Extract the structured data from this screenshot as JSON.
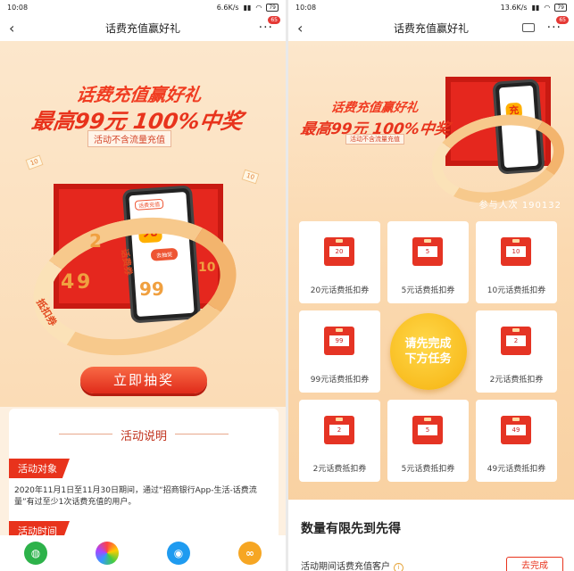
{
  "left": {
    "status": {
      "time": "10:08",
      "net": "6.6K/s",
      "battery": "79"
    },
    "nav": {
      "title": "话费充值赢好礼",
      "more": "···",
      "badge": "65"
    },
    "hero": {
      "headline": "话费充值赢好礼",
      "prize_line": "最高99元  100%中奖",
      "note": "活动不含流量充值",
      "app_header": "话费充值",
      "chong": "充",
      "phone_btn": "去抽奖",
      "ribbon_nums": [
        "2",
        "4",
        "9",
        "99",
        "10",
        "10",
        "10"
      ],
      "ribbon_words": [
        "抵扣券",
        "话费券"
      ]
    },
    "draw_button": "立即抽奖",
    "card": {
      "title": "活动说明",
      "tag1": "活动对象",
      "para": "2020年11月1日至11月30日期间，通过“招商银行App-生活-话费流量”有过至少1次话费充值的用户。",
      "tag2": "活动时间"
    },
    "share_icons": [
      "wechat-icon",
      "moments-icon",
      "qq-icon",
      "link-icon"
    ]
  },
  "right": {
    "status": {
      "time": "10:08",
      "net": "13.6K/s",
      "battery": "79"
    },
    "nav": {
      "title": "话费充值赢好礼",
      "badge": "65"
    },
    "hero": {
      "headline": "话费充值赢好礼",
      "prize_line": "最高99元  100%中奖",
      "note": "活动不含流量充值"
    },
    "participants": "参与人次 190132",
    "prizes": [
      {
        "amount": "20",
        "label": "20元话费抵扣券"
      },
      {
        "amount": "5",
        "label": "5元话费抵扣券"
      },
      {
        "amount": "10",
        "label": "10元话费抵扣券"
      },
      {
        "amount": "99",
        "label": "99元话费抵扣券"
      },
      {
        "amount": "2",
        "label": "2元话费抵扣券"
      },
      {
        "amount": "2",
        "label": "2元话费抵扣券"
      },
      {
        "amount": "5",
        "label": "5元话费抵扣券"
      },
      {
        "amount": "49",
        "label": "49元话费抵扣券"
      }
    ],
    "task": {
      "line1": "请先完成",
      "line2": "下方任务"
    },
    "info": {
      "heading": "数量有限先到先得",
      "row": "活动期间话费充值客户",
      "q": "i",
      "go": "去完成"
    }
  }
}
